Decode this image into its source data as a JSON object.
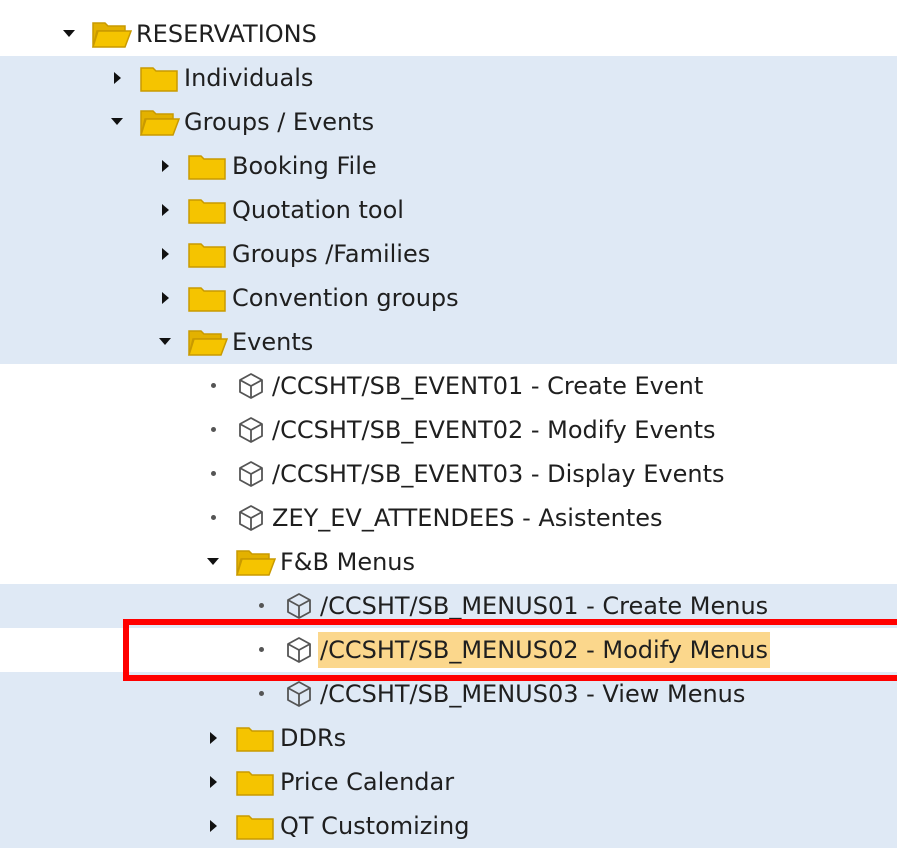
{
  "tree": {
    "nodes": [
      {
        "label": "RESERVATIONS",
        "level": 0,
        "type": "folder",
        "state": "expanded"
      },
      {
        "label": "Individuals",
        "level": 1,
        "type": "folder",
        "state": "collapsed"
      },
      {
        "label": "Groups / Events",
        "level": 1,
        "type": "folder",
        "state": "expanded"
      },
      {
        "label": "Booking File",
        "level": 2,
        "type": "folder",
        "state": "collapsed"
      },
      {
        "label": "Quotation tool",
        "level": 2,
        "type": "folder",
        "state": "collapsed"
      },
      {
        "label": "Groups /Families",
        "level": 2,
        "type": "folder",
        "state": "collapsed"
      },
      {
        "label": "Convention groups",
        "level": 2,
        "type": "folder",
        "state": "collapsed"
      },
      {
        "label": "Events",
        "level": 2,
        "type": "folder",
        "state": "expanded"
      },
      {
        "label": "/CCSHT/SB_EVENT01 - Create Event",
        "level": 3,
        "type": "transaction"
      },
      {
        "label": "/CCSHT/SB_EVENT02 - Modify Events",
        "level": 3,
        "type": "transaction"
      },
      {
        "label": "/CCSHT/SB_EVENT03 - Display Events",
        "level": 3,
        "type": "transaction"
      },
      {
        "label": "ZEY_EV_ATTENDEES - Asistentes",
        "level": 3,
        "type": "transaction"
      },
      {
        "label": "F&B Menus",
        "level": 3,
        "type": "folder",
        "state": "expanded"
      },
      {
        "label": "/CCSHT/SB_MENUS01 - Create Menus",
        "level": 4,
        "type": "transaction"
      },
      {
        "label": "/CCSHT/SB_MENUS02 - Modify Menus",
        "level": 4,
        "type": "transaction",
        "selected": true
      },
      {
        "label": "/CCSHT/SB_MENUS03 - View Menus",
        "level": 4,
        "type": "transaction"
      },
      {
        "label": "DDRs",
        "level": 3,
        "type": "folder",
        "state": "collapsed"
      },
      {
        "label": "Price Calendar",
        "level": 3,
        "type": "folder",
        "state": "collapsed"
      },
      {
        "label": "QT Customizing",
        "level": 3,
        "type": "folder",
        "state": "collapsed"
      }
    ]
  },
  "colors": {
    "row_band": "#dfe9f5",
    "row_plain": "#ffffff",
    "selection": "#fbd78c",
    "folder_fill": "#f5c400",
    "highlight_border": "#ff0000"
  },
  "icons": {
    "folder": "folder-icon",
    "folder_open": "folder-open-icon",
    "transaction": "transaction-cube-icon"
  }
}
